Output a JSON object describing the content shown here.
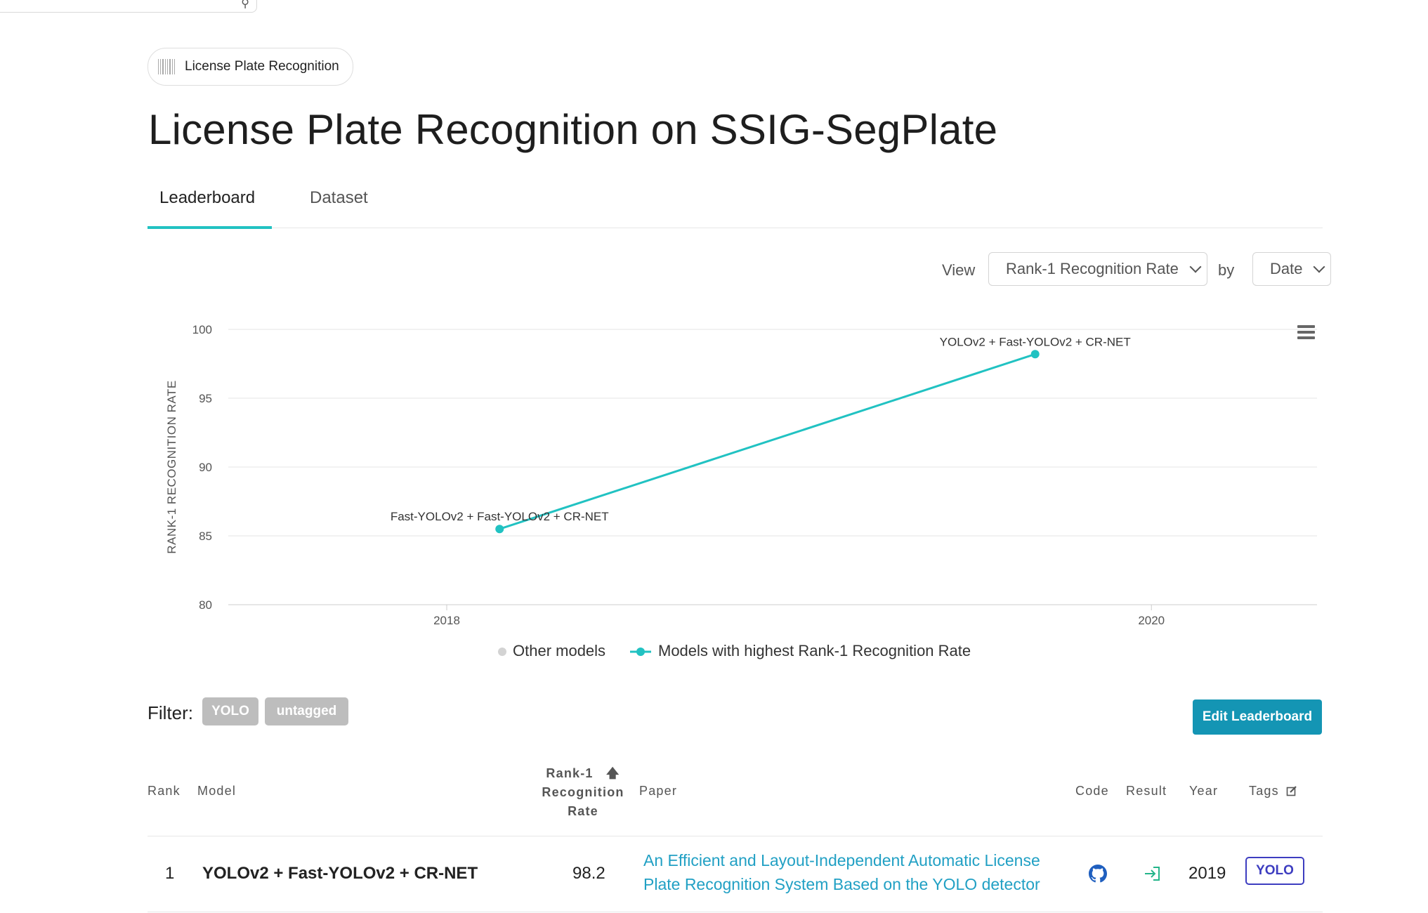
{
  "task_badge": {
    "label": "License Plate Recognition",
    "icon": "barcode-icon"
  },
  "title": "License Plate Recognition on SSIG-SegPlate",
  "tabs": [
    {
      "label": "Leaderboard",
      "active": true
    },
    {
      "label": "Dataset",
      "active": false
    }
  ],
  "view": {
    "view_label": "View",
    "metric_selected": "Rank-1 Recognition Rate",
    "by_label": "by",
    "order_selected": "Date"
  },
  "colors": {
    "accent": "#21c2c2",
    "link": "#21a0c4",
    "button": "#1495b4",
    "tag_outline": "#3d3dc0",
    "tag_gray": "#bdbdbd"
  },
  "chart_data": {
    "type": "line",
    "ylabel": "RANK-1 RECOGNITION RATE",
    "ylim": [
      80,
      100
    ],
    "yticks": [
      80,
      85,
      90,
      95,
      100
    ],
    "xticks": [
      "2018",
      "2020"
    ],
    "grid": true,
    "legend_position": "bottom-center",
    "series": [
      {
        "name": "Other models",
        "color": "#d3d3d3",
        "points": []
      },
      {
        "name": "Models with highest Rank-1 Recognition Rate",
        "color": "#21c2c2",
        "points": [
          {
            "x": 2018.15,
            "y": 85.5,
            "label": "Fast-YOLOv2 + Fast-YOLOv2 + CR-NET"
          },
          {
            "x": 2019.67,
            "y": 98.2,
            "label": "YOLOv2 + Fast-YOLOv2 + CR-NET"
          }
        ]
      }
    ],
    "menu_icon": "hamburger-menu-icon"
  },
  "filter": {
    "label": "Filter:",
    "tags": [
      "YOLO",
      "untagged"
    ]
  },
  "edit_button": "Edit Leaderboard",
  "table": {
    "headers": {
      "rank": "Rank",
      "model": "Model",
      "metric_line1": "Rank-1",
      "metric_line2": "Recognition",
      "metric_line3": "Rate",
      "paper": "Paper",
      "code": "Code",
      "result": "Result",
      "year": "Year",
      "tags": "Tags"
    },
    "rows": [
      {
        "rank": "1",
        "model": "YOLOv2 + Fast-YOLOv2 + CR-NET",
        "metric": "98.2",
        "paper_line1": "An Efficient and Layout-Independent Automatic License",
        "paper_line2": "Plate Recognition System Based on the YOLO detector",
        "code_icon": "github-icon",
        "result_icon": "result-link-icon",
        "year": "2019",
        "tag": "YOLO"
      }
    ]
  }
}
